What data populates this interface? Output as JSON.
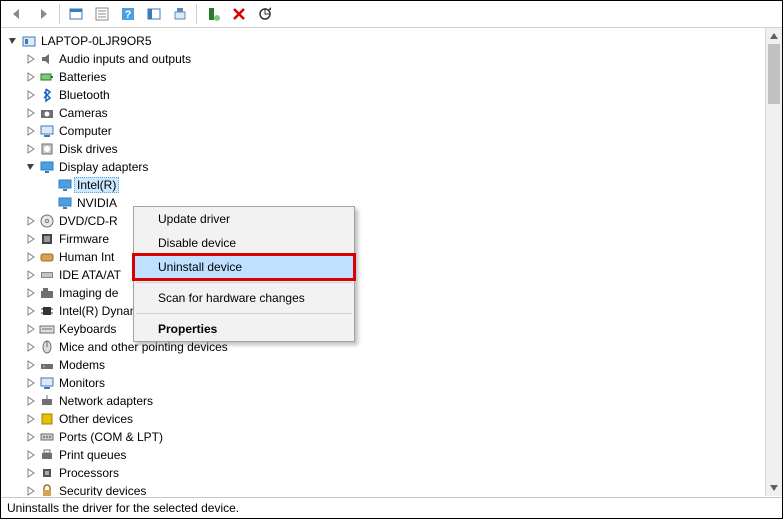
{
  "toolbar": {
    "icons": [
      "arrow-back",
      "arrow-forward",
      "sep",
      "show-hidden",
      "properties",
      "help",
      "refresh",
      "scan",
      "sep",
      "add-legacy",
      "remove",
      "update"
    ]
  },
  "root": {
    "name": "LAPTOP-0LJR9OR5",
    "expanded": true
  },
  "categories": [
    {
      "label": "Audio inputs and outputs",
      "icon": "audio",
      "expanded": false
    },
    {
      "label": "Batteries",
      "icon": "battery",
      "expanded": false
    },
    {
      "label": "Bluetooth",
      "icon": "bluetooth",
      "expanded": false
    },
    {
      "label": "Cameras",
      "icon": "camera",
      "expanded": false
    },
    {
      "label": "Computer",
      "icon": "computer",
      "expanded": false
    },
    {
      "label": "Disk drives",
      "icon": "disk",
      "expanded": false
    },
    {
      "label": "Display adapters",
      "icon": "display",
      "expanded": true,
      "children": [
        {
          "label": "Intel(R)",
          "icon": "display",
          "selected": true
        },
        {
          "label": "NVIDIA",
          "icon": "display",
          "selected": false
        }
      ]
    },
    {
      "label": "DVD/CD-R",
      "icon": "dvd",
      "expanded": false,
      "truncated": true
    },
    {
      "label": "Firmware",
      "icon": "firmware",
      "expanded": false
    },
    {
      "label": "Human Int",
      "icon": "hid",
      "expanded": false,
      "truncated": true
    },
    {
      "label": "IDE ATA/AT",
      "icon": "ide",
      "expanded": false,
      "truncated": true
    },
    {
      "label": "Imaging de",
      "icon": "imaging",
      "expanded": false,
      "truncated": true
    },
    {
      "label": "Intel(R) Dynamic Platform and Thermal Framework",
      "icon": "chip",
      "expanded": false
    },
    {
      "label": "Keyboards",
      "icon": "keyboard",
      "expanded": false
    },
    {
      "label": "Mice and other pointing devices",
      "icon": "mouse",
      "expanded": false
    },
    {
      "label": "Modems",
      "icon": "modem",
      "expanded": false
    },
    {
      "label": "Monitors",
      "icon": "monitor",
      "expanded": false
    },
    {
      "label": "Network adapters",
      "icon": "network",
      "expanded": false
    },
    {
      "label": "Other devices",
      "icon": "other",
      "expanded": false
    },
    {
      "label": "Ports (COM & LPT)",
      "icon": "ports",
      "expanded": false
    },
    {
      "label": "Print queues",
      "icon": "printer",
      "expanded": false
    },
    {
      "label": "Processors",
      "icon": "cpu",
      "expanded": false
    },
    {
      "label": "Security devices",
      "icon": "security",
      "expanded": false,
      "cutoff": true
    }
  ],
  "context_menu": {
    "items": [
      {
        "label": "Update driver",
        "type": "item"
      },
      {
        "label": "Disable device",
        "type": "item"
      },
      {
        "label": "Uninstall device",
        "type": "item",
        "highlighted": true,
        "hovered": true
      },
      {
        "type": "sep"
      },
      {
        "label": "Scan for hardware changes",
        "type": "item"
      },
      {
        "type": "sep"
      },
      {
        "label": "Properties",
        "type": "item",
        "bold": true
      }
    ]
  },
  "status_text": "Uninstalls the driver for the selected device."
}
